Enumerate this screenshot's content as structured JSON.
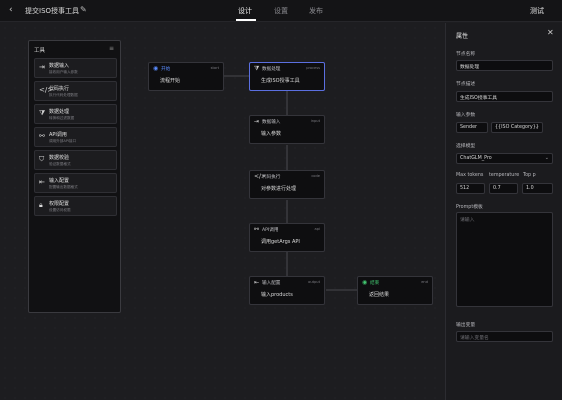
{
  "topbar": {
    "back_icon": "chevron-left-icon",
    "title": "提交ISO授事工具",
    "edit_icon": "pencil-icon",
    "tabs": [
      {
        "label": "设计",
        "active": true
      },
      {
        "label": "设置",
        "active": false
      },
      {
        "label": "发布",
        "active": false
      }
    ],
    "test_label": "测试"
  },
  "palette": {
    "title": "工具",
    "items": [
      {
        "icon": "input-icon",
        "name": "数据输入",
        "desc": "接收用户输入参数"
      },
      {
        "icon": "code-icon",
        "name": "代码执行",
        "desc": "执行代码处理数据"
      },
      {
        "icon": "filter-icon",
        "name": "数据处理",
        "desc": "转换和过滤数据"
      },
      {
        "icon": "api-icon",
        "name": "API调用",
        "desc": "调用外部API接口"
      },
      {
        "icon": "shield-icon",
        "name": "数据校验",
        "desc": "验证数据格式"
      },
      {
        "icon": "output-icon",
        "name": "输入配置",
        "desc": "配置输出数据格式"
      },
      {
        "icon": "lock-icon",
        "name": "权限配置",
        "desc": "设置访问权限"
      }
    ]
  },
  "nodes": [
    {
      "key": "start",
      "kind": "start",
      "icon": "play-icon",
      "type": "开始",
      "id": "start",
      "text": "流程开始"
    },
    {
      "key": "n1",
      "kind": "normal",
      "icon": "filter-icon",
      "type": "数据处理",
      "id": "process",
      "text": "生成ISO授事工具",
      "selected": true
    },
    {
      "key": "n2",
      "kind": "normal",
      "icon": "input-icon",
      "type": "数据输入",
      "id": "input",
      "text": "输入参数"
    },
    {
      "key": "n3",
      "kind": "normal",
      "icon": "code-icon",
      "type": "代码执行",
      "id": "code",
      "text": "对参数进行处理"
    },
    {
      "key": "n4",
      "kind": "normal",
      "icon": "api-icon",
      "type": "API调用",
      "id": "api",
      "text": "调用getArgs API"
    },
    {
      "key": "n5",
      "kind": "normal",
      "icon": "output-icon",
      "type": "输入配置",
      "id": "output",
      "text": "输入products"
    },
    {
      "key": "end",
      "kind": "end",
      "icon": "check-circle-icon",
      "type": "结束",
      "id": "end",
      "text": "返回结果"
    }
  ],
  "properties": {
    "title": "属性",
    "close_icon": "close-icon",
    "node_name_label": "节点名称",
    "node_name_value": "数据处理",
    "node_desc_label": "节点描述",
    "node_desc_value": "生成ISO授事工具",
    "input_params_label": "输入参数",
    "input_param_key": "Sender",
    "input_param_value": "{{ISO Category}}",
    "model_label": "选择模型",
    "model_value": "ChatGLM_Pro",
    "max_tokens_label": "Max tokens",
    "temperature_label": "temperature",
    "top_p_label": "Top p",
    "max_tokens_value": "512",
    "temperature_value": "0.7",
    "top_p_value": "1.0",
    "prompt_label": "Prompt模板",
    "prompt_placeholder": "请输入",
    "output_var_label": "输出变量",
    "output_var_placeholder": "请输入变量名"
  }
}
